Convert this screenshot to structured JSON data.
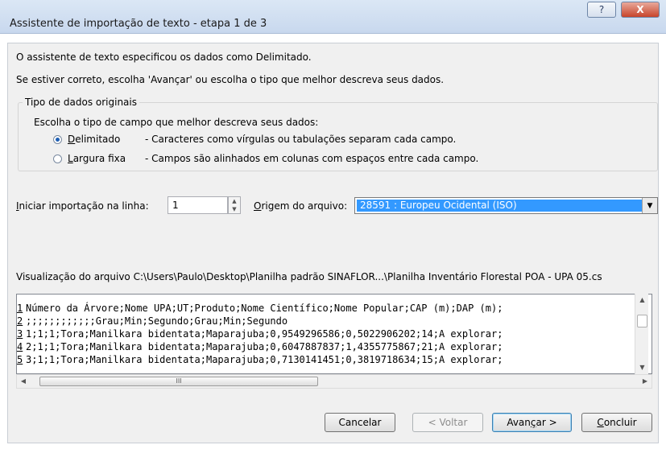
{
  "window": {
    "title": "Assistente de importação de texto - etapa 1 de 3",
    "help_label": "?",
    "close_label": "X"
  },
  "intro": {
    "line1": "O assistente de texto especificou os dados como Delimitado.",
    "line2": "Se estiver correto, escolha 'Avançar' ou escolha o tipo que melhor descreva seus dados."
  },
  "data_type": {
    "group_label": "Tipo de dados originais",
    "prompt": "Escolha o tipo de campo que melhor descreva seus dados:",
    "options": [
      {
        "label_first": "D",
        "label_rest": "elimitado",
        "description": "- Caracteres como vírgulas ou tabulações separam cada campo.",
        "checked": true
      },
      {
        "label_first": "L",
        "label_rest": "argura fixa",
        "description": "- Campos são alinhados em colunas com espaços entre cada campo.",
        "checked": false
      }
    ]
  },
  "start_row": {
    "label_first": "I",
    "label_rest": "niciar importação na linha:",
    "value": "1"
  },
  "file_origin": {
    "label_first": "O",
    "label_rest": "rigem do arquivo:",
    "value": "28591 : Europeu Ocidental (ISO)"
  },
  "preview": {
    "label": "Visualização do arquivo C:\\Users\\Paulo\\Desktop\\Planilha padrão SINAFLOR...\\Planilha Inventário Florestal POA - UPA 05.cs",
    "lines": [
      {
        "num": "1",
        "text": "Número da Árvore;Nome UPA;UT;Produto;Nome Científico;Nome Popular;CAP (m);DAP (m);"
      },
      {
        "num": "2",
        "text": ";;;;;;;;;;;;Grau;Min;Segundo;Grau;Min;Segundo"
      },
      {
        "num": "3",
        "text": "1;1;1;Tora;Manilkara bidentata;Maparajuba;0,9549296586;0,5022906202;14;A explorar;"
      },
      {
        "num": "4",
        "text": "2;1;1;Tora;Manilkara bidentata;Maparajuba;0,6047887837;1,4355775867;21;A explorar;"
      },
      {
        "num": "5",
        "text": "3;1;1;Tora;Manilkara bidentata;Maparajuba;0,7130141451;0,3819718634;15;A explorar;"
      }
    ]
  },
  "buttons": {
    "cancel": "Cancelar",
    "back": "< Voltar",
    "next_prefix": "Avan",
    "next_mnemonic": "ç",
    "next_suffix": "ar >",
    "finish_first": "C",
    "finish_rest": "oncluir"
  },
  "colors": {
    "selection": "#3399ff",
    "close_button": "#c7442b",
    "dialog_bg": "#f0f0f0"
  }
}
